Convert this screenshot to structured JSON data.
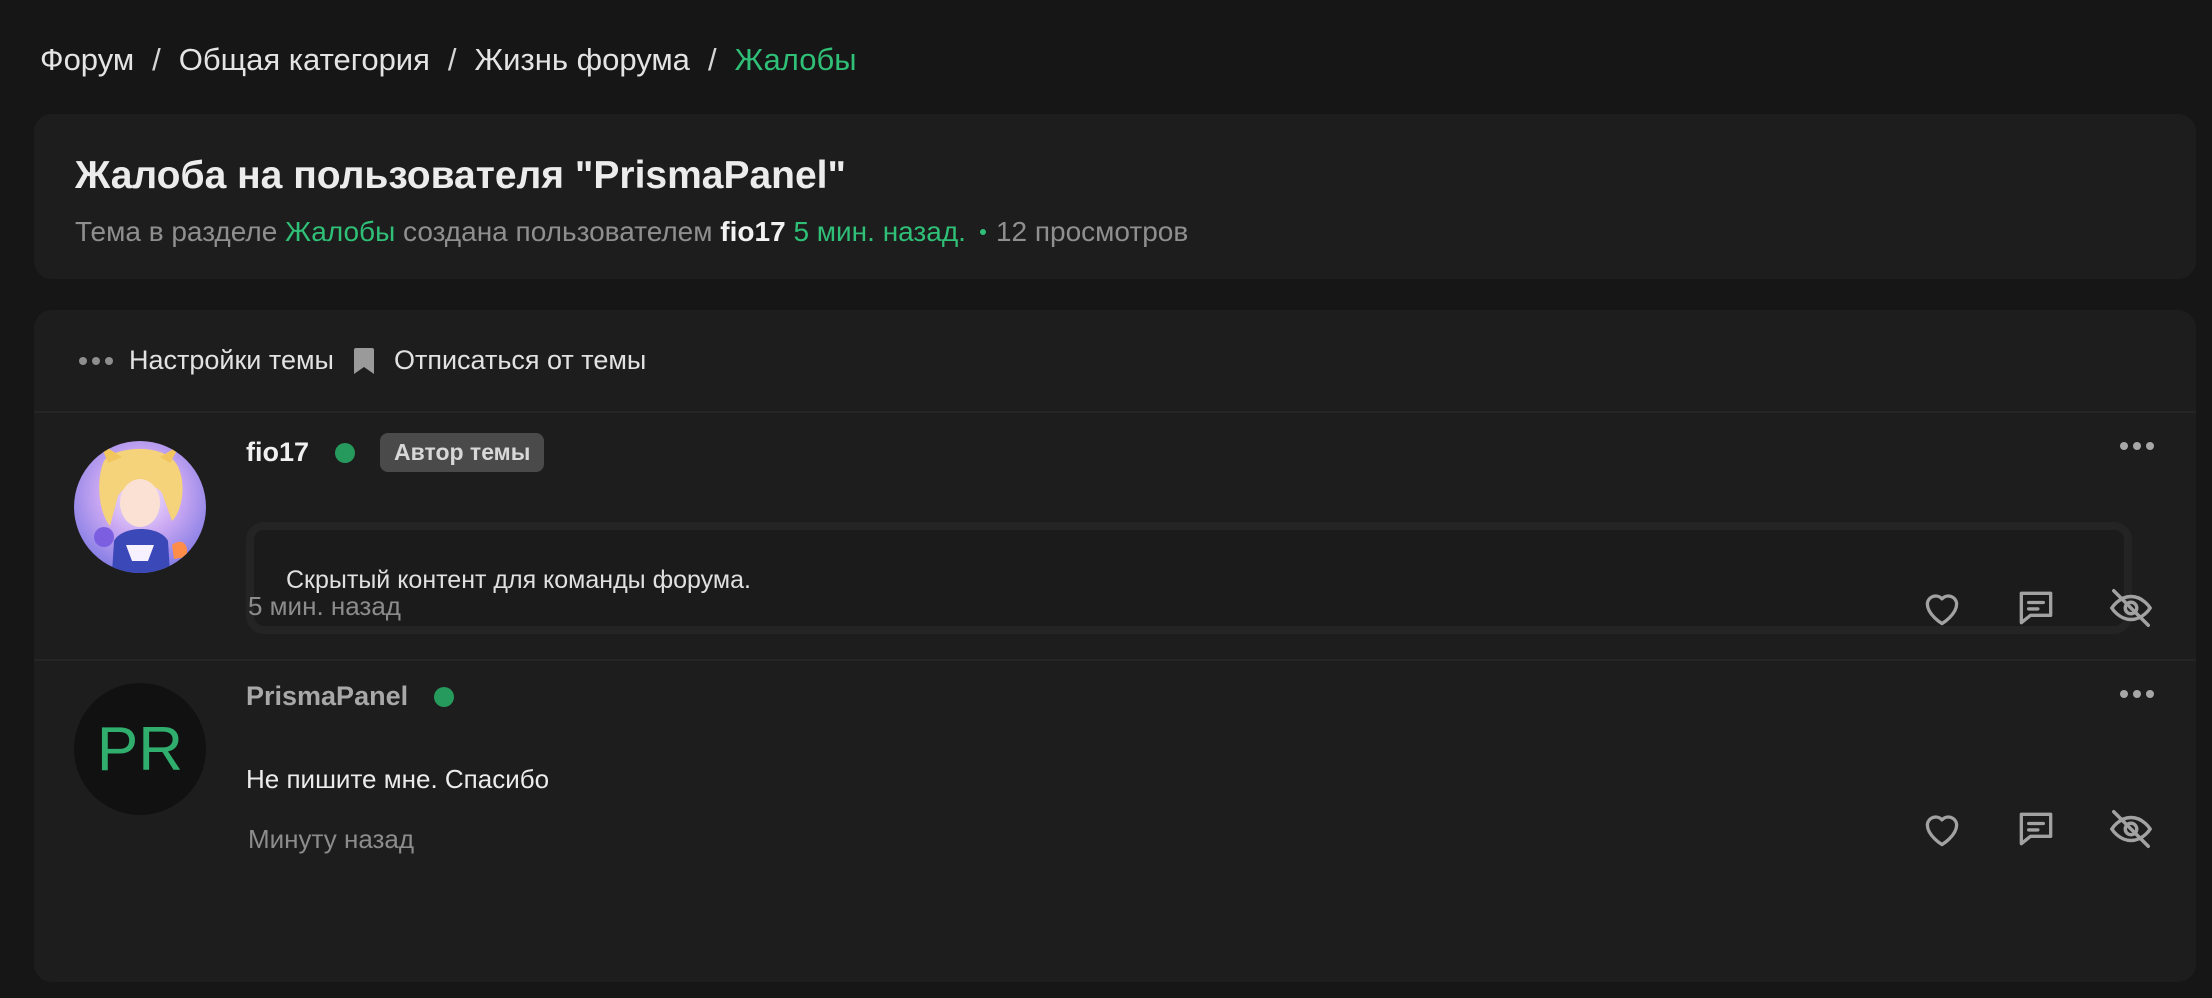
{
  "breadcrumb": {
    "items": [
      "Форум",
      "Общая категория",
      "Жизнь форума"
    ],
    "separator": "/",
    "current": "Жалобы"
  },
  "thread": {
    "title": "Жалоба на пользователя \"PrismaPanel\"",
    "meta_prefix": "Тема в разделе",
    "section": "Жалобы",
    "meta_created": "создана пользователем",
    "author": "fio17",
    "time": "5 мин. назад.",
    "views": "12 просмотров"
  },
  "toolbar": {
    "settings_label": "Настройки темы",
    "unsubscribe_label": "Отписаться от темы"
  },
  "posts": [
    {
      "author": "fio17",
      "badge": "Автор темы",
      "content": "Скрытый контент для команды форума.",
      "timestamp": "5 мин. назад"
    },
    {
      "author": "PrismaPanel",
      "avatar_initials": "PR",
      "content": "Не пишите мне. Спасибо",
      "timestamp": "Минуту назад"
    }
  ],
  "icons": {
    "like": "heart-icon",
    "reply": "message-icon",
    "hide": "eye-off-icon",
    "more": "more-dots-icon",
    "bookmark": "bookmark-icon"
  },
  "colors": {
    "accent": "#2fbf77",
    "online": "#26995c",
    "background": "#161616",
    "card": "#1d1d1d"
  }
}
